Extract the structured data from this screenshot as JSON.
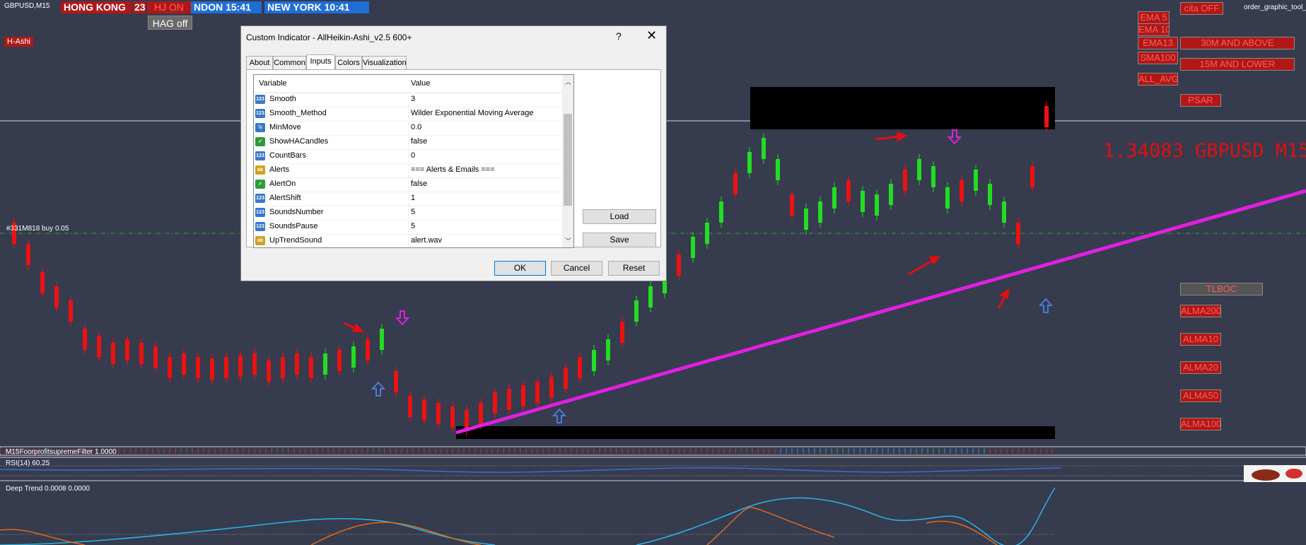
{
  "symbol": "GBPUSD,M15",
  "clocks": {
    "hongkong": "HONG KONG",
    "hongkong_num": "23",
    "hj": "HJ ON",
    "london": "NDON  15:41",
    "newyork": "NEW YORK  10:41"
  },
  "hag_button": "HAG off",
  "hashi_label": "H-Ashi",
  "order_text": "order_graphic_tool_v",
  "right_buttons": {
    "cita": "cita OFF",
    "ema5": "EMA 5",
    "ema10": "EMA 10",
    "ema13": "EMA13",
    "sma100": "SMA100",
    "all_avg": "ALL_AVG",
    "m30": "30M AND ABOVE",
    "m15": "15M AND LOWER",
    "psar": "PSAR",
    "tlboc": "TLBOC",
    "alma200": "ALMA200",
    "alma10": "ALMA10",
    "alma20": "ALMA20",
    "alma50": "ALMA50",
    "alma100": "ALMA100"
  },
  "price_label": "1.34083 GBPUSD M15",
  "position_label": "#331M818 buy 0.05",
  "indicators": {
    "filter": "M15FoorprofitsupremeFilter 1.0000",
    "rsi": "RSI(14) 60.25",
    "deep_trend": "Deep Trend 0.0008 0.0000"
  },
  "dialog": {
    "title": "Custom Indicator - AllHeikin-Ashi_v2.5 600+",
    "help": "?",
    "close": "✕",
    "tabs": [
      "About",
      "Common",
      "Inputs",
      "Colors",
      "Visualization"
    ],
    "active_tab": "Inputs",
    "columns": {
      "variable": "Variable",
      "value": "Value"
    },
    "rows": [
      {
        "icon": "123",
        "name": "Smooth",
        "value": "3"
      },
      {
        "icon": "123",
        "name": "Smooth_Method",
        "value": "Wilder Exponential Moving Average"
      },
      {
        "icon": "½",
        "name": "MinMove",
        "value": "0.0"
      },
      {
        "icon": "bool",
        "name": "ShowHACandles",
        "value": "false"
      },
      {
        "icon": "123",
        "name": "CountBars",
        "value": "0"
      },
      {
        "icon": "ab",
        "name": "Alerts",
        "value": "=== Alerts & Emails ==="
      },
      {
        "icon": "bool",
        "name": "AlertOn",
        "value": "false"
      },
      {
        "icon": "123",
        "name": "AlertShift",
        "value": "1"
      },
      {
        "icon": "123",
        "name": "SoundsNumber",
        "value": "5"
      },
      {
        "icon": "123",
        "name": "SoundsPause",
        "value": "5"
      },
      {
        "icon": "ab",
        "name": "UpTrendSound",
        "value": "alert.wav"
      }
    ],
    "buttons": {
      "load": "Load",
      "save": "Save",
      "ok": "OK",
      "cancel": "Cancel",
      "reset": "Reset"
    }
  },
  "colors": {
    "bull": "#22dd22",
    "bear": "#ee1111",
    "trendline": "#e020e0",
    "background": "#363b4e",
    "clock_red": "#b01818",
    "clock_blue": "#1f6ed6"
  }
}
